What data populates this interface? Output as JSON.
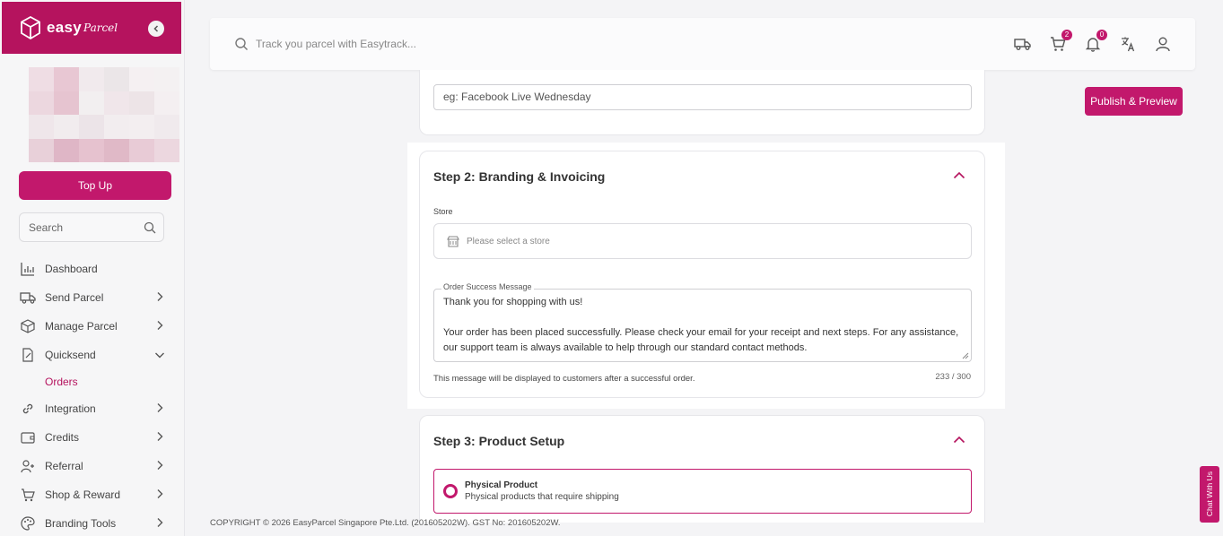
{
  "brand": {
    "name": "easy",
    "script": "Parcel"
  },
  "sidebar": {
    "topup_label": "Top Up",
    "search_placeholder": "Search",
    "items": [
      {
        "label": "Dashboard",
        "icon": "bar-chart-icon"
      },
      {
        "label": "Send Parcel",
        "icon": "truck-icon"
      },
      {
        "label": "Manage Parcel",
        "icon": "box-icon"
      },
      {
        "label": "Quicksend",
        "icon": "document-edit-icon"
      },
      {
        "label": "Orders"
      },
      {
        "label": "Integration",
        "icon": "link-icon"
      },
      {
        "label": "Credits",
        "icon": "wallet-icon"
      },
      {
        "label": "Referral",
        "icon": "user-add-icon"
      },
      {
        "label": "Shop & Reward",
        "icon": "cart-icon"
      },
      {
        "label": "Branding Tools",
        "icon": "palette-icon"
      }
    ]
  },
  "topbar": {
    "search_placeholder": "Track you parcel with Easytrack...",
    "cart_count": "2",
    "notification_count": "0"
  },
  "publish_label": "Publish & Preview",
  "step1": {
    "input_value": "eg: Facebook Live Wednesday"
  },
  "step2": {
    "title": "Step 2: Branding & Invoicing",
    "store_label": "Store",
    "store_placeholder": "Please select a store",
    "message_label": "Order Success Message",
    "message_line1": "Thank you for shopping with us!",
    "message_line2": "Your order has been placed successfully. Please check your email for your receipt and next steps. For any assistance, our support team is always available to help through our standard contact methods.",
    "helper": "This message will be displayed to customers after a successful order.",
    "counter": "233 / 300"
  },
  "step3": {
    "title": "Step 3: Product Setup",
    "option_title": "Physical Product",
    "option_sub": "Physical products that require shipping"
  },
  "footer": "COPYRIGHT © 2026 EasyParcel Singapore Pte.Ltd. (201605202W). GST No: 201605202W.",
  "chat_label": "Chat With Us",
  "colors": {
    "brand": "#b5135e",
    "accent": "#c2186c"
  }
}
